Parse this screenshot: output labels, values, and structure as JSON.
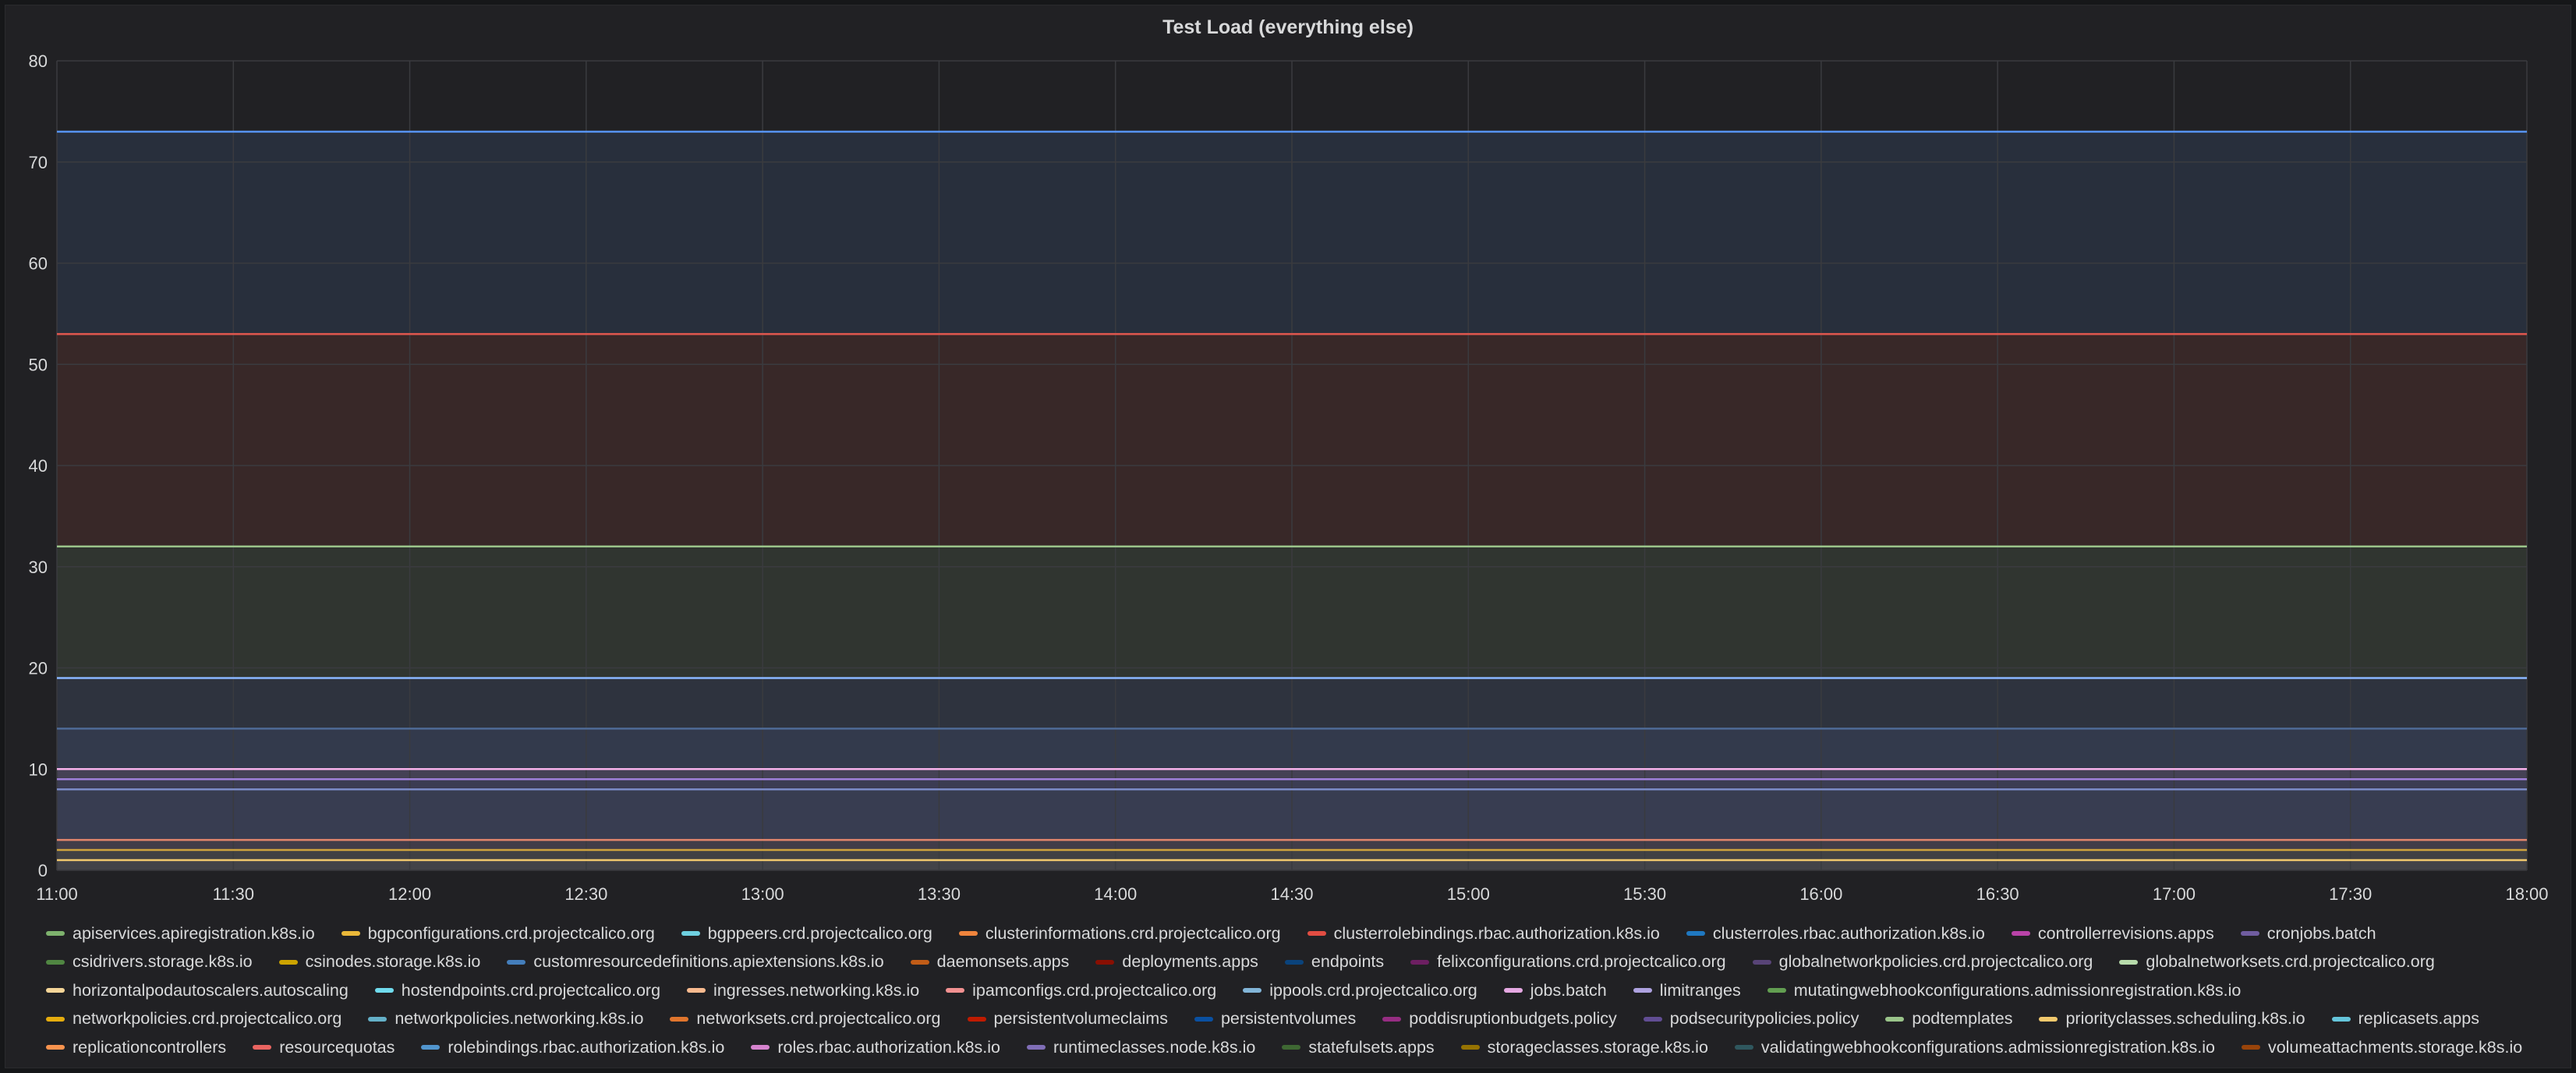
{
  "panel": {
    "title": "Test Load (everything else)"
  },
  "colors": {
    "background": "#212124",
    "grid": "#3a3b3f",
    "text": "#d8d9da"
  },
  "chart_data": {
    "type": "area",
    "title": "Test Load (everything else)",
    "xlabel": "",
    "ylabel": "",
    "x_ticks": [
      "11:00",
      "11:30",
      "12:00",
      "12:30",
      "13:00",
      "13:30",
      "14:00",
      "14:30",
      "15:00",
      "15:30",
      "16:00",
      "16:30",
      "17:00",
      "17:30",
      "18:00"
    ],
    "y_ticks": [
      0,
      10,
      20,
      30,
      40,
      50,
      60,
      70,
      80
    ],
    "ylim": [
      0,
      80
    ],
    "xlim": [
      "11:00",
      "18:00"
    ],
    "grid": true,
    "legend_position": "bottom",
    "lines": [
      {
        "value": 73,
        "color": "#5794f2"
      },
      {
        "value": 53,
        "color": "#e0574e"
      },
      {
        "value": 32,
        "color": "#9ac48a"
      },
      {
        "value": 19,
        "color": "#8ab8ff"
      },
      {
        "value": 14,
        "color": "#4e6a96"
      },
      {
        "value": 10,
        "color": "#f6b1ea"
      },
      {
        "value": 9,
        "color": "#9d7fd8"
      },
      {
        "value": 8,
        "color": "#7b8ac6"
      },
      {
        "value": 3,
        "color": "#e2866b"
      },
      {
        "value": 2,
        "color": "#cfa33e"
      },
      {
        "value": 1,
        "color": "#f2c96d"
      }
    ],
    "series": [
      {
        "name": "apiservices.apiregistration.k8s.io",
        "color": "#7eb26d"
      },
      {
        "name": "bgpconfigurations.crd.projectcalico.org",
        "color": "#eab839"
      },
      {
        "name": "bgppeers.crd.projectcalico.org",
        "color": "#6ed0e0"
      },
      {
        "name": "clusterinformations.crd.projectcalico.org",
        "color": "#ef843c"
      },
      {
        "name": "clusterrolebindings.rbac.authorization.k8s.io",
        "color": "#e24d42"
      },
      {
        "name": "clusterroles.rbac.authorization.k8s.io",
        "color": "#1f78c1"
      },
      {
        "name": "controllerrevisions.apps",
        "color": "#ba43a9"
      },
      {
        "name": "cronjobs.batch",
        "color": "#705da0"
      },
      {
        "name": "csidrivers.storage.k8s.io",
        "color": "#508642"
      },
      {
        "name": "csinodes.storage.k8s.io",
        "color": "#cca300"
      },
      {
        "name": "customresourcedefinitions.apiextensions.k8s.io",
        "color": "#447ebc"
      },
      {
        "name": "daemonsets.apps",
        "color": "#c15c17"
      },
      {
        "name": "deployments.apps",
        "color": "#890f02"
      },
      {
        "name": "endpoints",
        "color": "#0a437c"
      },
      {
        "name": "felixconfigurations.crd.projectcalico.org",
        "color": "#6d1f62"
      },
      {
        "name": "globalnetworkpolicies.crd.projectcalico.org",
        "color": "#584477"
      },
      {
        "name": "globalnetworksets.crd.projectcalico.org",
        "color": "#b7dbab"
      },
      {
        "name": "horizontalpodautoscalers.autoscaling",
        "color": "#f4d598"
      },
      {
        "name": "hostendpoints.crd.projectcalico.org",
        "color": "#70dbed"
      },
      {
        "name": "ingresses.networking.k8s.io",
        "color": "#f9ba8f"
      },
      {
        "name": "ipamconfigs.crd.projectcalico.org",
        "color": "#f29191"
      },
      {
        "name": "ippools.crd.projectcalico.org",
        "color": "#82b5d8"
      },
      {
        "name": "jobs.batch",
        "color": "#e5a8e2"
      },
      {
        "name": "limitranges",
        "color": "#aea2e0"
      },
      {
        "name": "mutatingwebhookconfigurations.admissionregistration.k8s.io",
        "color": "#629e51"
      },
      {
        "name": "networkpolicies.crd.projectcalico.org",
        "color": "#e5ac0e"
      },
      {
        "name": "networkpolicies.networking.k8s.io",
        "color": "#64b0c8"
      },
      {
        "name": "networksets.crd.projectcalico.org",
        "color": "#e0752d"
      },
      {
        "name": "persistentvolumeclaims",
        "color": "#bf1b00"
      },
      {
        "name": "persistentvolumes",
        "color": "#0a50a1"
      },
      {
        "name": "poddisruptionbudgets.policy",
        "color": "#962d82"
      },
      {
        "name": "podsecuritypolicies.policy",
        "color": "#614d93"
      },
      {
        "name": "podtemplates",
        "color": "#9ac48a"
      },
      {
        "name": "priorityclasses.scheduling.k8s.io",
        "color": "#f2c96d"
      },
      {
        "name": "replicasets.apps",
        "color": "#65c5db"
      },
      {
        "name": "replicationcontrollers",
        "color": "#f9934e"
      },
      {
        "name": "resourcequotas",
        "color": "#ea6460"
      },
      {
        "name": "rolebindings.rbac.authorization.k8s.io",
        "color": "#5195ce"
      },
      {
        "name": "roles.rbac.authorization.k8s.io",
        "color": "#d683ce"
      },
      {
        "name": "runtimeclasses.node.k8s.io",
        "color": "#806eb7"
      },
      {
        "name": "statefulsets.apps",
        "color": "#3f6833"
      },
      {
        "name": "storageclasses.storage.k8s.io",
        "color": "#967302"
      },
      {
        "name": "validatingwebhookconfigurations.admissionregistration.k8s.io",
        "color": "#2f575e"
      },
      {
        "name": "volumeattachments.storage.k8s.io",
        "color": "#99440a"
      }
    ]
  }
}
